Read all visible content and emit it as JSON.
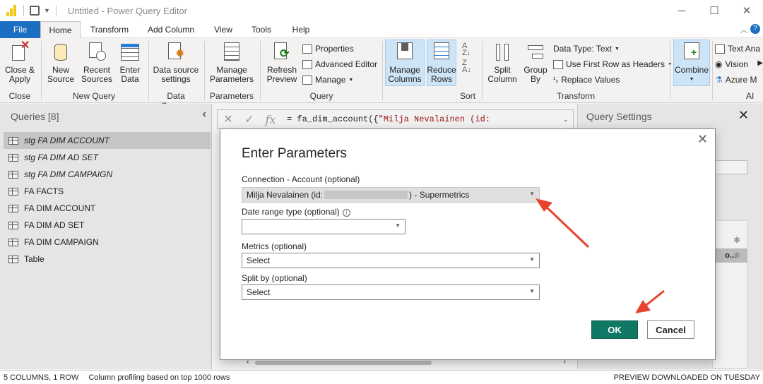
{
  "window": {
    "title": "Untitled - Power Query Editor",
    "minimize": "─",
    "maximize": "☐",
    "close": "✕"
  },
  "tabs": [
    {
      "label": "File"
    },
    {
      "label": "Home"
    },
    {
      "label": "Transform"
    },
    {
      "label": "Add Column"
    },
    {
      "label": "View"
    },
    {
      "label": "Tools"
    },
    {
      "label": "Help"
    }
  ],
  "ribbon": {
    "close_apply": "Close &\nApply",
    "new_source": "New\nSource",
    "recent_sources": "Recent\nSources",
    "enter_data": "Enter\nData",
    "data_source_settings": "Data source\nsettings",
    "manage_parameters": "Manage\nParameters",
    "refresh_preview": "Refresh\nPreview",
    "properties": "Properties",
    "advanced_editor": "Advanced Editor",
    "manage": "Manage",
    "manage_columns": "Manage\nColumns",
    "reduce_rows": "Reduce\nRows",
    "split_column": "Split\nColumn",
    "group_by": "Group\nBy",
    "data_type": "Data Type: Text",
    "use_first_row": "Use First Row as Headers",
    "replace_values": "Replace Values",
    "combine": "Combine",
    "text_analytics": "Text Ana",
    "vision": "Vision",
    "azure_ml": "Azure M",
    "groups": {
      "close": "Close",
      "new_query": "New Query",
      "data_sources": "Data Sourc...",
      "parameters": "Parameters",
      "query": "Query",
      "sort": "Sort",
      "transform": "Transform",
      "ai": "AI"
    }
  },
  "queries_panel": {
    "header": "Queries [8]",
    "items": [
      {
        "label": "stg FA DIM ACCOUNT",
        "italic": true,
        "selected": true
      },
      {
        "label": "stg FA DIM AD SET",
        "italic": true
      },
      {
        "label": "stg FA DIM CAMPAIGN",
        "italic": true
      },
      {
        "label": "FA FACTS"
      },
      {
        "label": "FA DIM ACCOUNT"
      },
      {
        "label": "FA DIM AD SET"
      },
      {
        "label": "FA DIM CAMPAIGN"
      },
      {
        "label": "Table"
      }
    ]
  },
  "formula_bar": {
    "prefix": "= fa_dim_account({",
    "string": "\"Milja Nevalainen (id:"
  },
  "query_settings": {
    "header": "Query Settings"
  },
  "dialog": {
    "title": "Enter Parameters",
    "fields": [
      {
        "label": "Connection - Account (optional)",
        "value_before": "Milja Nevalainen (id:",
        "value_after": ") - Supermetrics"
      },
      {
        "label": "Date range type (optional)",
        "value": ""
      },
      {
        "label": "Metrics (optional)",
        "value": "Select"
      },
      {
        "label": "Split by (optional)",
        "value": "Select"
      }
    ],
    "ok": "OK",
    "cancel": "Cancel"
  },
  "status_bar": {
    "columns": "5 COLUMNS, 1 ROW",
    "profiling": "Column profiling based on top 1000 rows",
    "preview": "PREVIEW DOWNLOADED ON TUESDAY"
  },
  "colors": {
    "accent": "#1b6ec2",
    "ok_button": "#117865",
    "arrow": "#e8432e"
  }
}
